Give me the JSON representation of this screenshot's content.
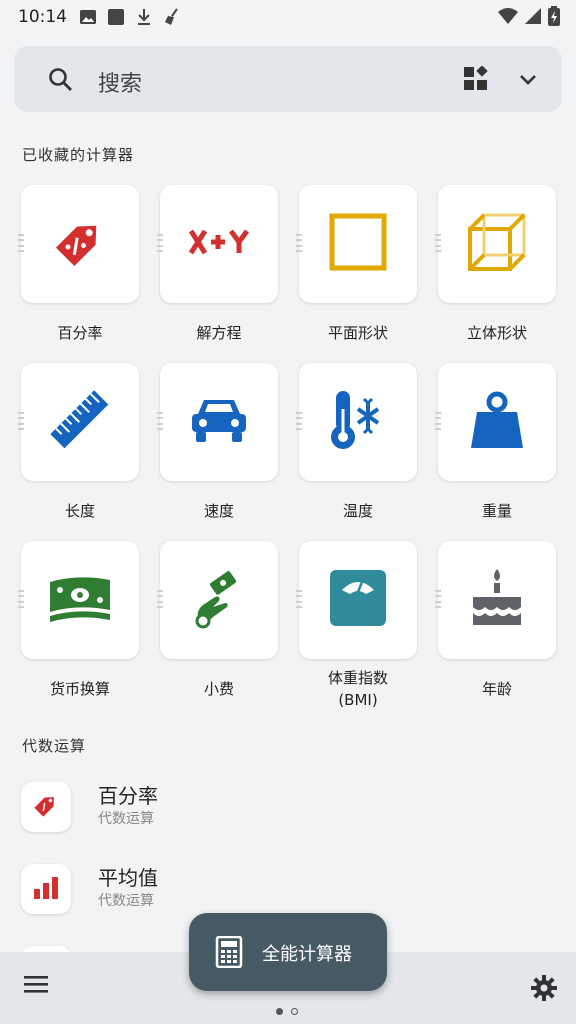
{
  "status": {
    "time": "10:14"
  },
  "search": {
    "placeholder": "搜索"
  },
  "favorites": {
    "title": "已收藏的计算器",
    "items": [
      {
        "label": "百分率",
        "icon": "percent-tag-icon",
        "color": "#d32f2f"
      },
      {
        "label": "解方程",
        "icon": "x-plus-y-icon",
        "color": "#d32f2f"
      },
      {
        "label": "平面形状",
        "icon": "square-icon",
        "color": "#e0a800"
      },
      {
        "label": "立体形状",
        "icon": "cube-icon",
        "color": "#e0a800"
      },
      {
        "label": "长度",
        "icon": "ruler-icon",
        "color": "#1565c0"
      },
      {
        "label": "速度",
        "icon": "car-icon",
        "color": "#1565c0"
      },
      {
        "label": "温度",
        "icon": "thermometer-icon",
        "color": "#1565c0"
      },
      {
        "label": "重量",
        "icon": "weight-icon",
        "color": "#1565c0"
      },
      {
        "label": "货币换算",
        "icon": "money-icon",
        "color": "#2e7d32"
      },
      {
        "label": "小费",
        "icon": "tip-hand-icon",
        "color": "#2e7d32"
      },
      {
        "label": "体重指数",
        "label2": "(BMI)",
        "icon": "scale-icon",
        "color": "#2e8b9a"
      },
      {
        "label": "年龄",
        "icon": "cake-icon",
        "color": "#5f6368"
      }
    ]
  },
  "algebra": {
    "title": "代数运算",
    "items": [
      {
        "title": "百分率",
        "subtitle": "代数运算",
        "icon": "percent-tag-icon"
      },
      {
        "title": "平均值",
        "subtitle": "代数运算",
        "icon": "bar-chart-icon"
      }
    ]
  },
  "fab": {
    "label": "全能计算器"
  }
}
